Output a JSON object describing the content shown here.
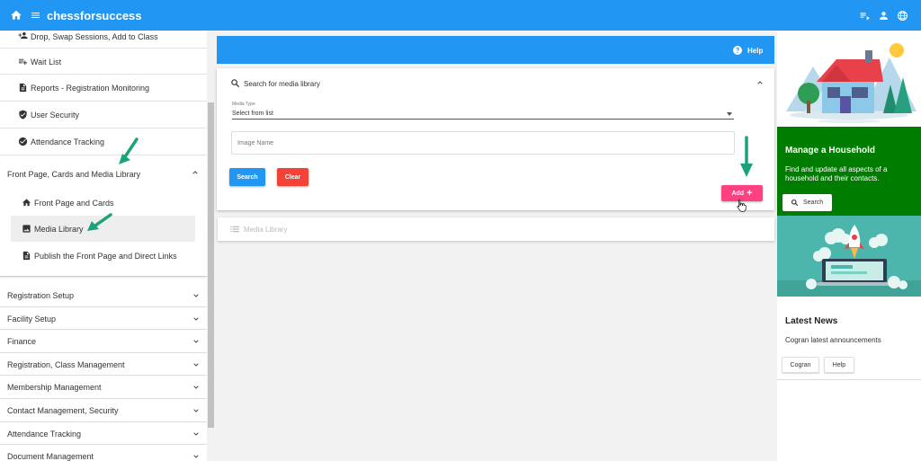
{
  "app": {
    "title": "chessforsuccess"
  },
  "sidebar": {
    "items": [
      {
        "label": "Drop, Swap Sessions, Add to Class",
        "icon": "person-add-icon"
      },
      {
        "label": "Wait List",
        "icon": "playlist-add-icon"
      },
      {
        "label": "Reports - Registration Monitoring",
        "icon": "document-icon"
      },
      {
        "label": "User Security",
        "icon": "shield-icon"
      },
      {
        "label": "Attendance Tracking",
        "icon": "check-circle-icon"
      }
    ],
    "expanded_section": {
      "label": "Front Page, Cards and Media Library",
      "children": [
        {
          "label": "Front Page and Cards",
          "icon": "home-icon"
        },
        {
          "label": "Media Library",
          "icon": "image-icon",
          "active": true
        },
        {
          "label": "Publish the Front Page and Direct Links",
          "icon": "document-icon"
        }
      ]
    },
    "sections": [
      "Registration Setup",
      "Facility Setup",
      "Finance",
      "Registration, Class Management",
      "Membership Management",
      "Contact Management, Security",
      "Attendance Tracking",
      "Document Management"
    ]
  },
  "main": {
    "help_label": "Help",
    "search_card": {
      "title": "Search for media library",
      "media_type_label": "Media Type",
      "media_type_value": "Select from list",
      "image_name_placeholder": "Image Name",
      "search_label": "Search",
      "clear_label": "Clear",
      "add_label": "Add"
    },
    "media_library_label": "Media Library"
  },
  "right_panel": {
    "household": {
      "title": "Manage a Household",
      "text": "Find and update all aspects of a household and their contacts.",
      "button": "Search"
    },
    "news": {
      "title": "Latest News",
      "text": "Cogran latest announcements",
      "buttons": [
        "Cogran",
        "Help"
      ]
    }
  },
  "colors": {
    "primary": "#2196f3",
    "danger": "#f44336",
    "accent": "#ff4081",
    "household_green": "#007c00",
    "annotation_arrow": "#1aa37a"
  }
}
